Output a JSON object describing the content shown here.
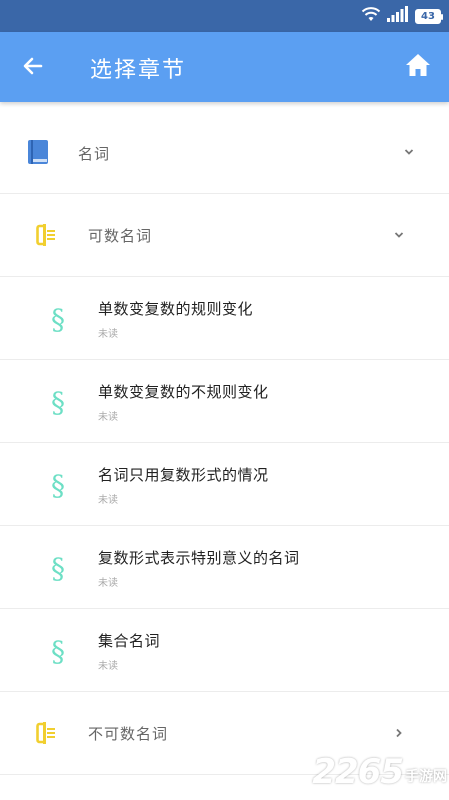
{
  "status_bar": {
    "battery": "43"
  },
  "app_bar": {
    "title": "选择章节"
  },
  "rows": [
    {
      "label": "名词"
    },
    {
      "label": "可数名词"
    },
    {
      "title": "单数变复数的规则变化",
      "status": "未读"
    },
    {
      "title": "单数变复数的不规则变化",
      "status": "未读"
    },
    {
      "title": "名词只用复数形式的情况",
      "status": "未读"
    },
    {
      "title": "复数形式表示特别意义的名词",
      "status": "未读"
    },
    {
      "title": "集合名词",
      "status": "未读"
    },
    {
      "label": "不可数名词"
    }
  ],
  "icons": {
    "item_glyph": "§"
  },
  "colors": {
    "app_bar": "#5b9ff2",
    "status_bar": "#3a67a8",
    "book_icon": "#4a86d9",
    "section_icon": "#f1cf2f",
    "item_icon": "#6ddfc5"
  },
  "watermark": {
    "number": "2265",
    "suffix": "手游网"
  }
}
